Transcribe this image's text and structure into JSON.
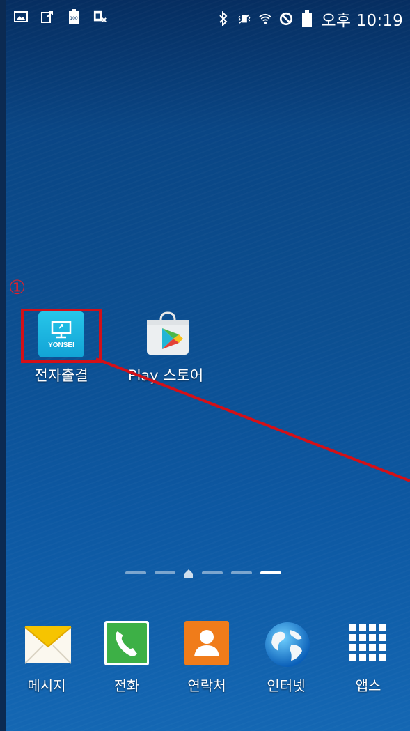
{
  "status_bar": {
    "time": "오후 10:19",
    "left_icons": [
      "image-icon",
      "upload-icon",
      "battery-100-icon",
      "sim-x-icon"
    ],
    "right_icons": [
      "bluetooth-icon",
      "vibrate-icon",
      "wifi-icon",
      "no-disturb-icon",
      "battery-icon"
    ]
  },
  "marker": {
    "text": "①",
    "color": "#e2202a"
  },
  "home_apps": [
    {
      "label": "전자출결",
      "icon": "yonsei-attendance-icon",
      "icon_text": "YONSEI",
      "highlighted": true
    },
    {
      "label": "Play 스토어",
      "icon": "play-store-icon"
    }
  ],
  "page_indicator": {
    "pages": 5,
    "home_index": 2,
    "active_index": 5
  },
  "dock": [
    {
      "label": "메시지",
      "icon": "message-envelope-icon"
    },
    {
      "label": "전화",
      "icon": "phone-icon"
    },
    {
      "label": "연락처",
      "icon": "contacts-icon"
    },
    {
      "label": "인터넷",
      "icon": "globe-icon"
    },
    {
      "label": "앱스",
      "icon": "apps-grid-icon"
    }
  ],
  "colors": {
    "highlight": "#d31018",
    "wallpaper_top": "#062e61",
    "wallpaper_bottom": "#1467b3"
  }
}
